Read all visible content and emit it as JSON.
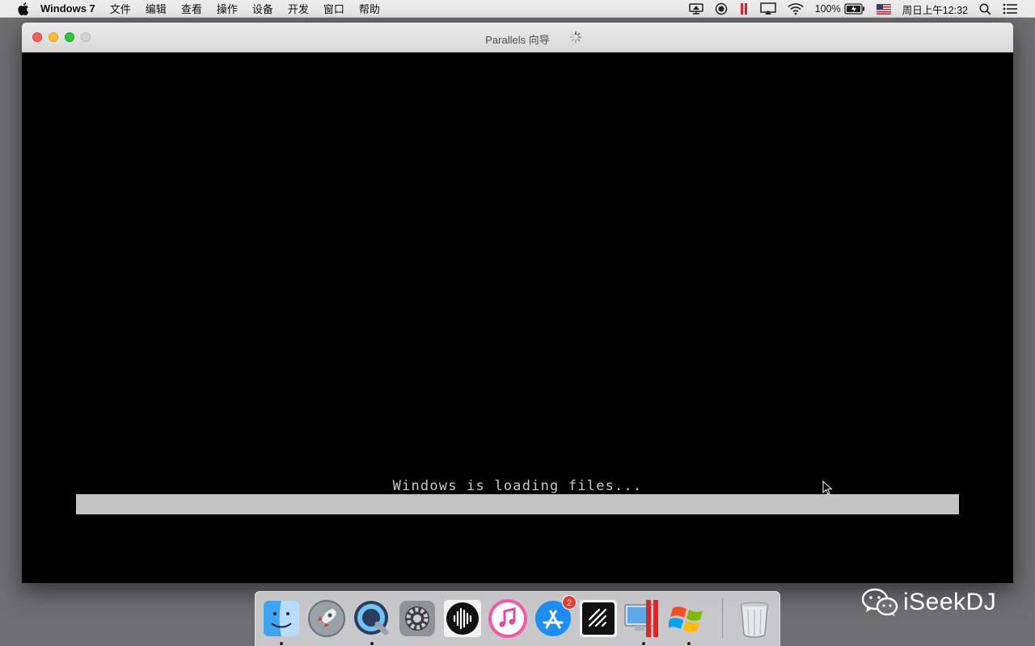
{
  "menubar": {
    "app_name": "Windows 7",
    "items": [
      "文件",
      "编辑",
      "查看",
      "操作",
      "设备",
      "开发",
      "窗口",
      "帮助"
    ],
    "battery": "100%",
    "clock": "周日上午12:32"
  },
  "window": {
    "title": "Parallels 向导"
  },
  "vm": {
    "boot_message": "Windows is loading files...",
    "progress_percent": 100
  },
  "dock": {
    "items": [
      {
        "name": "Finder",
        "running": true
      },
      {
        "name": "Launchpad",
        "running": false
      },
      {
        "name": "QuickTime Player",
        "running": true
      },
      {
        "name": "System Preferences",
        "running": false
      },
      {
        "name": "Audio app",
        "running": false
      },
      {
        "name": "iTunes",
        "running": false
      },
      {
        "name": "App Store",
        "running": false,
        "badge": "2"
      },
      {
        "name": "Dark app",
        "running": false
      },
      {
        "name": "Parallels Desktop",
        "running": true
      },
      {
        "name": "Windows 7",
        "running": true
      },
      {
        "name": "Trash",
        "running": false
      }
    ]
  },
  "watermark": {
    "text": "iSeekDJ"
  },
  "colors": {
    "menubar": "#ececec",
    "desktop": "#6f6f71",
    "vm_background": "#000000",
    "progress_fill": "#c4c4c4",
    "close": "#fc5f57",
    "minimize": "#fdbc2e",
    "zoom": "#29c840",
    "badge": "#e8392f"
  }
}
